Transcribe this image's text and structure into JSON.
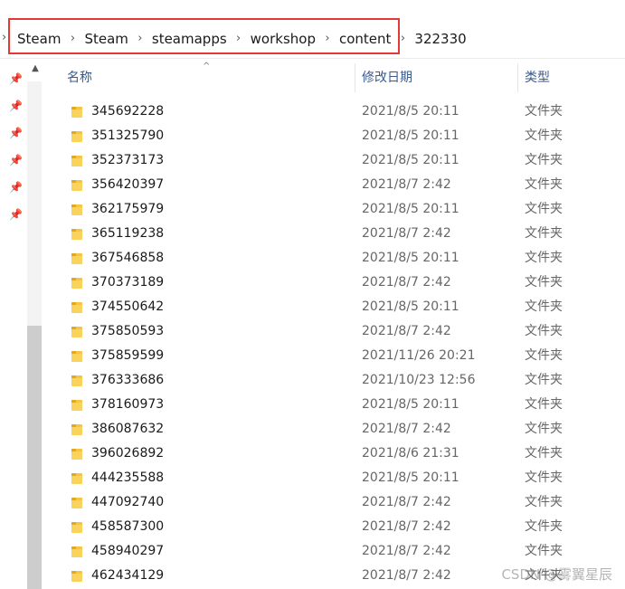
{
  "address": {
    "crumbs": [
      "Steam",
      "Steam",
      "steamapps",
      "workshop",
      "content",
      "322330"
    ],
    "highlight_color": "#e53935"
  },
  "columns": {
    "name": "名称",
    "date": "修改日期",
    "type": "类型"
  },
  "rows": [
    {
      "name": "345692228",
      "date": "2021/8/5 20:11",
      "type": "文件夹"
    },
    {
      "name": "351325790",
      "date": "2021/8/5 20:11",
      "type": "文件夹"
    },
    {
      "name": "352373173",
      "date": "2021/8/5 20:11",
      "type": "文件夹"
    },
    {
      "name": "356420397",
      "date": "2021/8/7 2:42",
      "type": "文件夹"
    },
    {
      "name": "362175979",
      "date": "2021/8/5 20:11",
      "type": "文件夹"
    },
    {
      "name": "365119238",
      "date": "2021/8/7 2:42",
      "type": "文件夹"
    },
    {
      "name": "367546858",
      "date": "2021/8/5 20:11",
      "type": "文件夹"
    },
    {
      "name": "370373189",
      "date": "2021/8/7 2:42",
      "type": "文件夹"
    },
    {
      "name": "374550642",
      "date": "2021/8/5 20:11",
      "type": "文件夹"
    },
    {
      "name": "375850593",
      "date": "2021/8/7 2:42",
      "type": "文件夹"
    },
    {
      "name": "375859599",
      "date": "2021/11/26 20:21",
      "type": "文件夹"
    },
    {
      "name": "376333686",
      "date": "2021/10/23 12:56",
      "type": "文件夹"
    },
    {
      "name": "378160973",
      "date": "2021/8/5 20:11",
      "type": "文件夹"
    },
    {
      "name": "386087632",
      "date": "2021/8/7 2:42",
      "type": "文件夹"
    },
    {
      "name": "396026892",
      "date": "2021/8/6 21:31",
      "type": "文件夹"
    },
    {
      "name": "444235588",
      "date": "2021/8/5 20:11",
      "type": "文件夹"
    },
    {
      "name": "447092740",
      "date": "2021/8/7 2:42",
      "type": "文件夹"
    },
    {
      "name": "458587300",
      "date": "2021/8/7 2:42",
      "type": "文件夹"
    },
    {
      "name": "458940297",
      "date": "2021/8/7 2:42",
      "type": "文件夹"
    },
    {
      "name": "462434129",
      "date": "2021/8/7 2:42",
      "type": "文件夹"
    }
  ],
  "watermark": "CSDN @雾翼星辰",
  "icons": {
    "folder": "folder-icon",
    "pin": "pin-icon",
    "sort": "sort-ascending-icon",
    "chevron": "chevron-right-icon"
  },
  "colors": {
    "folder": "#f6c544",
    "header_text": "#3a5a8c",
    "highlight": "#e53935"
  }
}
